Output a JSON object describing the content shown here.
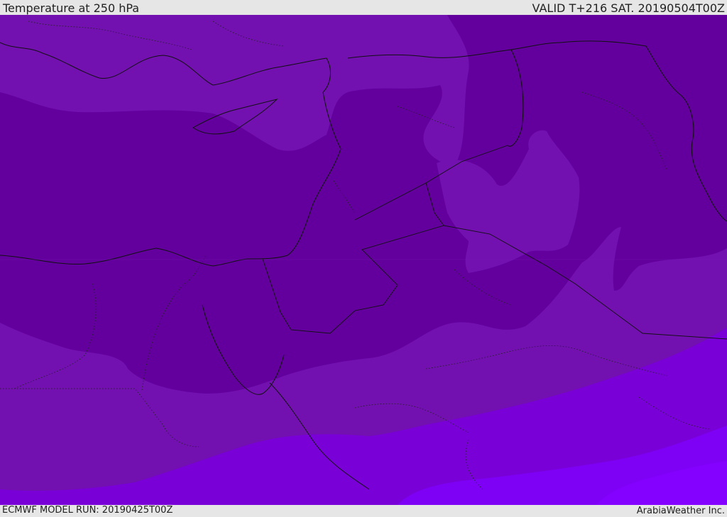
{
  "header": {
    "title": "Temperature at 250 hPa",
    "valid": "VALID T+216 SAT. 20190504T00Z"
  },
  "footer": {
    "model_run": "ECMWF MODEL RUN: 20190425T00Z",
    "credit": "ArabiaWeather Inc."
  },
  "map": {
    "colors": {
      "darkest": "#63009d",
      "dark": "#7210b0",
      "medium": "#7a00d8",
      "light": "#7e00f5",
      "lightest": "#8400ff",
      "lines": "#111111"
    }
  }
}
